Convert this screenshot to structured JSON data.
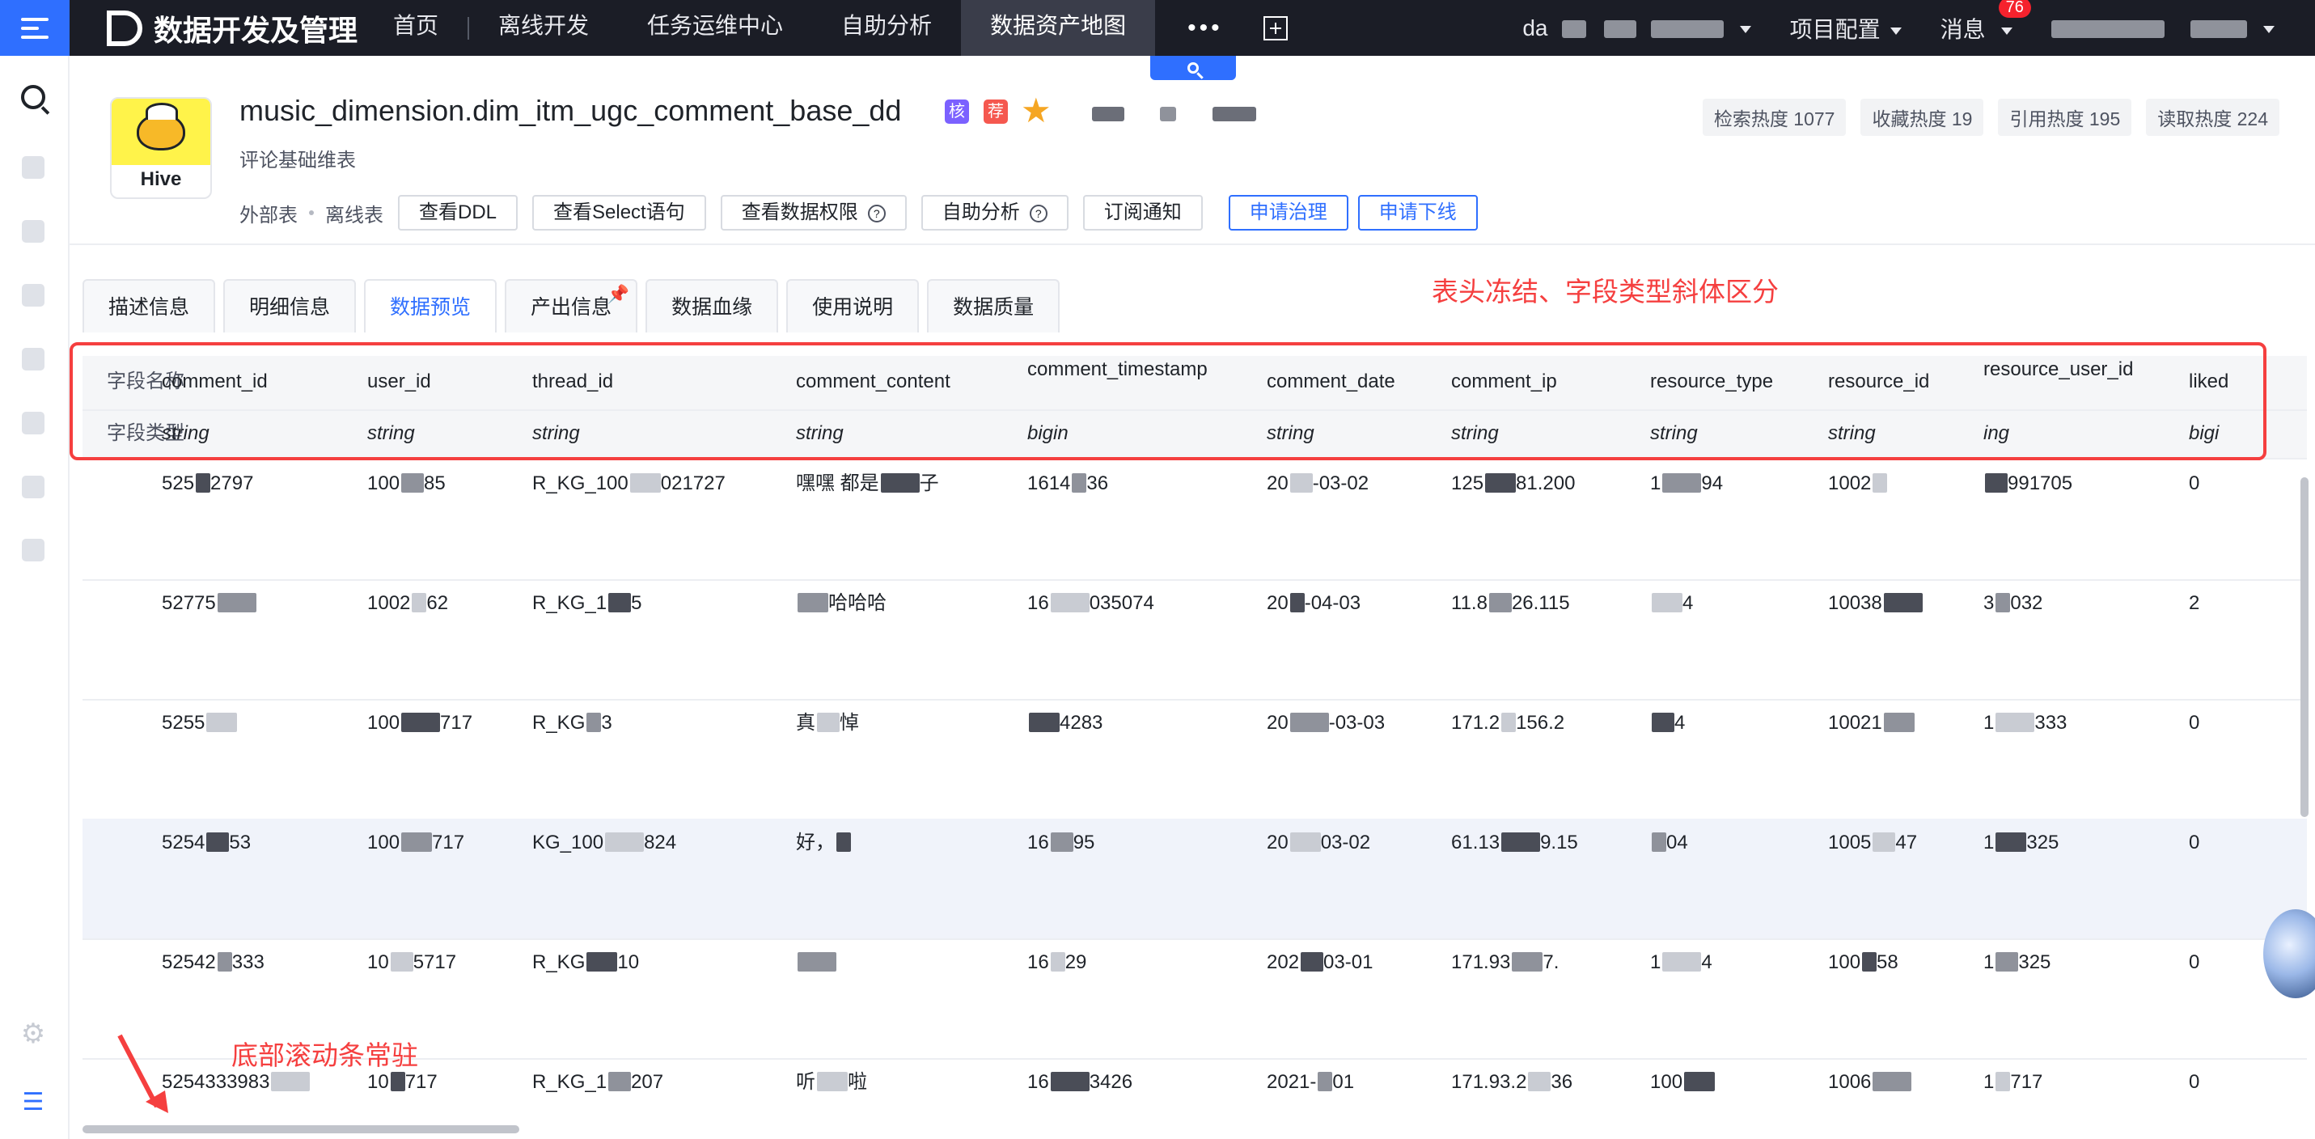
{
  "app": {
    "title": "数据开发及管理"
  },
  "nav": {
    "items": [
      "首页",
      "离线开发",
      "任务运维中心",
      "自助分析",
      "数据资产地图"
    ],
    "active_index": 4,
    "more": "•••"
  },
  "topbar_right": {
    "user_prefix": "da",
    "project_config": "项目配置",
    "messages": "消息",
    "message_count": "76"
  },
  "table_meta": {
    "name": "music_dimension.dim_itm_ugc_comment_base_dd",
    "badge_core": "核",
    "badge_recommend": "荐",
    "badge_core_color": "#7b61ff",
    "badge_recommend_color": "#f5584f",
    "description": "评论基础维表",
    "engine": "Hive",
    "table_kind": "外部表",
    "table_mode": "离线表"
  },
  "hotness": [
    {
      "label": "检索热度 1077"
    },
    {
      "label": "收藏热度 19"
    },
    {
      "label": "引用热度 195"
    },
    {
      "label": "读取热度 224"
    }
  ],
  "actions": {
    "view_ddl": "查看DDL",
    "view_select": "查看Select语句",
    "view_permissions": "查看数据权限",
    "self_analysis": "自助分析",
    "subscribe": "订阅通知",
    "apply_govern": "申请治理",
    "apply_offline": "申请下线",
    "help_glyph": "?"
  },
  "tabs": [
    "描述信息",
    "明细信息",
    "数据预览",
    "产出信息",
    "数据血缘",
    "使用说明",
    "数据质量"
  ],
  "active_tab": 2,
  "annotations": {
    "header_note": "表头冻结、字段类型斜体区分",
    "scroll_note": "底部滚动条常驻"
  },
  "grid": {
    "row_label_name": "字段名称",
    "row_label_type": "字段类型",
    "columns": [
      {
        "name": "comment_id",
        "type": "string"
      },
      {
        "name": "user_id",
        "type": "string"
      },
      {
        "name": "thread_id",
        "type": "string"
      },
      {
        "name": "comment_content",
        "type": "string"
      },
      {
        "name": "comment_timestamp",
        "type": "bigin"
      },
      {
        "name": "comment_date",
        "type": "string"
      },
      {
        "name": "comment_ip",
        "type": "string"
      },
      {
        "name": "resource_type",
        "type": "string"
      },
      {
        "name": "resource_id",
        "type": "string"
      },
      {
        "name": "resource_user_id",
        "type": "ing"
      },
      {
        "name": "liked",
        "type": "bigi"
      }
    ],
    "rows": [
      [
        "525",
        "100",
        "R_KG_100",
        "嘿嘿 都是",
        "1614",
        "20",
        "125",
        "1",
        "1002",
        "",
        "0"
      ],
      [
        "52775",
        "1002",
        "R_KG_1",
        "",
        "16",
        "20",
        "11.8",
        "",
        "10038",
        "3",
        "2"
      ],
      [
        "5255",
        "100",
        "R_KG",
        "真",
        "",
        "20",
        "171.2",
        "",
        "10021",
        "1",
        "0"
      ],
      [
        "5254",
        "100",
        "KG_100",
        "好，",
        "16",
        "20",
        "61.13",
        "",
        "1005",
        "1",
        "0"
      ],
      [
        "52542",
        "10",
        "R_KG",
        "",
        "16",
        "202",
        "171.93",
        "1",
        "100",
        "1",
        "0"
      ],
      [
        "5254333983",
        "10",
        "R_KG_1",
        "听",
        "16",
        "2021-",
        "171.93.2",
        "100",
        "1006",
        "1",
        "0"
      ]
    ],
    "rows_tail": [
      [
        "2797",
        "85",
        "021727",
        "子",
        "36",
        "-03-02",
        "81.200",
        "94",
        "",
        "991705"
      ],
      [
        "",
        "62",
        "5",
        "哈哈哈",
        "035074",
        "-04-03",
        "26.115",
        "4",
        "",
        "032"
      ],
      [
        "",
        "717",
        "3",
        "悼",
        "4283",
        "-03-03",
        "156.2",
        "4",
        "",
        "333"
      ],
      [
        "53",
        "717",
        "824",
        "",
        "95",
        "03-02",
        "9.15",
        "04",
        "47",
        "325"
      ],
      [
        "333",
        "5717",
        "10",
        "",
        "29",
        "03-01",
        "7.",
        "4",
        "58",
        "325"
      ],
      [
        "",
        "717",
        "207",
        "啦",
        "3426",
        "01",
        "36",
        "",
        "",
        "717"
      ]
    ]
  }
}
